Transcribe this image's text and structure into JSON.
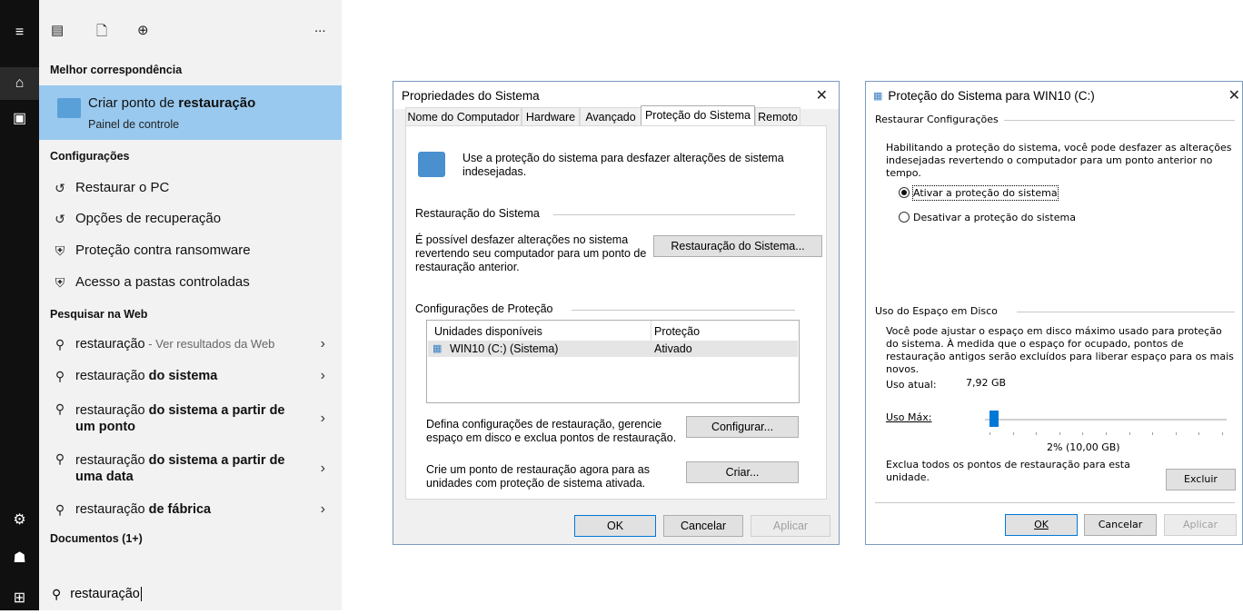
{
  "taskbar": {
    "icons": [
      "hamburger-icon",
      "home-icon",
      "contact-card-icon",
      "gear-icon",
      "person-icon",
      "windows-logo-icon"
    ]
  },
  "start": {
    "top_icons": [
      "apps-icon",
      "document-icon",
      "globe-icon"
    ],
    "more": "...",
    "best_match_header": "Melhor correspondência",
    "best_match": {
      "title_normal": "Criar ponto de ",
      "title_bold": "restauração",
      "subtitle": "Painel de controle"
    },
    "settings_header": "Configurações",
    "settings": [
      {
        "label": "Restaurar o PC",
        "icon": "history-icon"
      },
      {
        "label": "Opções de recuperação",
        "icon": "history-icon"
      },
      {
        "label": "Proteção contra ransomware",
        "icon": "shield-icon"
      },
      {
        "label": "Acesso a pastas controladas",
        "icon": "shield-icon"
      }
    ],
    "web_header": "Pesquisar na Web",
    "web": [
      {
        "normal": "restauração",
        "bold": "",
        "suffix": " - Ver resultados da Web"
      },
      {
        "normal": "restauração ",
        "bold": "do sistema",
        "suffix": ""
      },
      {
        "normal": "restauração ",
        "bold": "do sistema a partir de",
        "line2": "um ponto",
        "suffix": ""
      },
      {
        "normal": "restauração ",
        "bold": "do sistema a partir de",
        "line2": "uma data",
        "suffix": ""
      },
      {
        "normal": "restauração ",
        "bold": "de fábrica",
        "suffix": ""
      }
    ],
    "docs_header": "Documentos (1+)",
    "search_value": "restauração"
  },
  "sysprops": {
    "title": "Propriedades do Sistema",
    "tabs": [
      "Nome do Computador",
      "Hardware",
      "Avançado",
      "Proteção do Sistema",
      "Remoto"
    ],
    "intro": "Use a proteção do sistema para desfazer alterações de sistema indesejadas.",
    "restore_group": "Restauração do Sistema",
    "restore_text": "É possível desfazer alterações no sistema revertendo seu computador para um ponto de restauração anterior.",
    "restore_button": "Restauração do Sistema...",
    "protection_group": "Configurações de Proteção",
    "table_headers": [
      "Unidades disponíveis",
      "Proteção"
    ],
    "table_rows": [
      [
        "WIN10 (C:) (Sistema)",
        "Ativado"
      ]
    ],
    "configure_text": "Defina configurações de restauração, gerencie espaço em disco e exclua pontos de restauração.",
    "configure_button": "Configurar...",
    "create_text": "Crie um ponto de restauração agora para as unidades com proteção de sistema ativada.",
    "create_button": "Criar...",
    "ok": "OK",
    "cancel": "Cancelar",
    "apply": "Aplicar"
  },
  "protect": {
    "title": "Proteção do Sistema para WIN10 (C:)",
    "restore_group": "Restaurar Configurações",
    "restore_text": "Habilitando a proteção do sistema, você pode desfazer as alterações indesejadas revertendo o computador para um ponto anterior no tempo.",
    "radio_on": "Ativar a proteção do sistema",
    "radio_off": "Desativar a proteção do sistema",
    "disk_group": "Uso do Espaço em Disco",
    "disk_text": "Você pode ajustar o espaço em disco máximo usado para proteção do sistema. À medida que o espaço for ocupado, pontos de restauração antigos serão excluídos para liberar espaço para os mais novos.",
    "current_label": "Uso atual:",
    "current_value": "7,92 GB",
    "max_label": "Uso Máx:",
    "slider_fraction": 0.02,
    "slider_readout": "2% (10,00 GB)",
    "delete_text": "Exclua todos os pontos de restauração para esta unidade.",
    "delete_button": "Excluir",
    "ok": "OK",
    "cancel": "Cancelar",
    "apply": "Aplicar"
  }
}
